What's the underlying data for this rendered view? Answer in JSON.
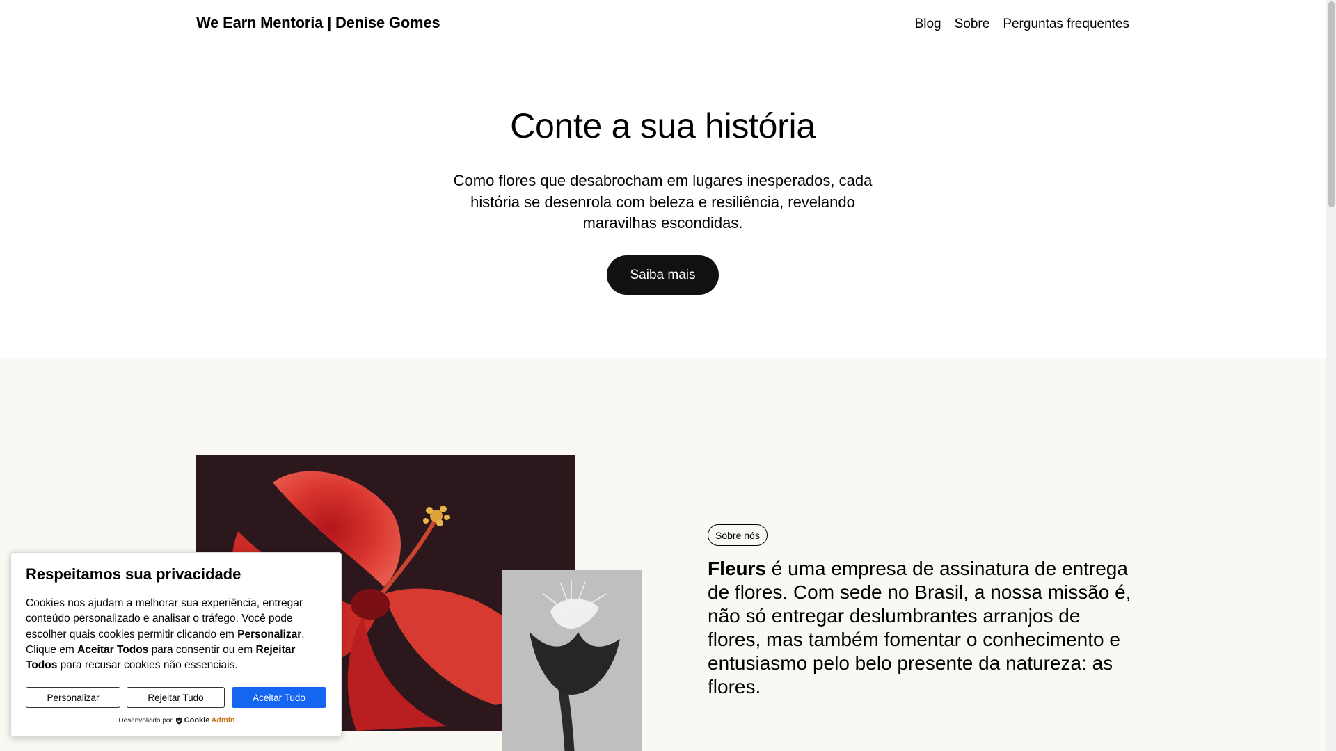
{
  "header": {
    "site_title": "We Earn Mentoria | Denise Gomes",
    "nav": [
      "Blog",
      "Sobre",
      "Perguntas frequentes"
    ]
  },
  "hero": {
    "title": "Conte a sua história",
    "text": "Como flores que desabrocham em lugares inesperados, cada história se desenrola com beleza e resiliência, revelando maravilhas escondidas.",
    "button_label": "Saiba mais"
  },
  "about": {
    "badge": "Sobre nós",
    "brand": "Fleurs",
    "text": " é uma empresa de assinatura de entrega de flores. Com sede no Brasil, a nossa missão é, não só entregar deslumbrantes arranjos de flores, mas também fomentar o conhecimento e entusiasmo pelo belo presente da natureza: as flores."
  },
  "cookie": {
    "title": "Respeitamos sua privacidade",
    "body_1": "Cookies nos ajudam a melhorar sua experiência, entregar conteúdo personalizado e analisar o tráfego. Você pode escolher quais cookies permitir clicando em ",
    "body_b1": "Personalizar",
    "body_2": ". Clique em ",
    "body_b2": "Aceitar Todos",
    "body_3": " para consentir ou em ",
    "body_b3": "Rejeitar Todos",
    "body_4": " para recusar cookies não essenciais.",
    "btn_customize": "Personalizar",
    "btn_reject": "Rejeitar Tudo",
    "btn_accept": "Aceitar Tudo",
    "powered_by": "Desenvolvido por",
    "logo_cookie": "Cookie",
    "logo_admin": "Admin"
  },
  "colors": {
    "accent": "#1565f0",
    "hero_button": "#111111",
    "section_bg": "#f9f8f2",
    "cookieadmin_orange": "#c5781b"
  },
  "images": {
    "hibiscus": "red-hibiscus-flower-photo",
    "flower2": "black-white-flower-photo"
  }
}
